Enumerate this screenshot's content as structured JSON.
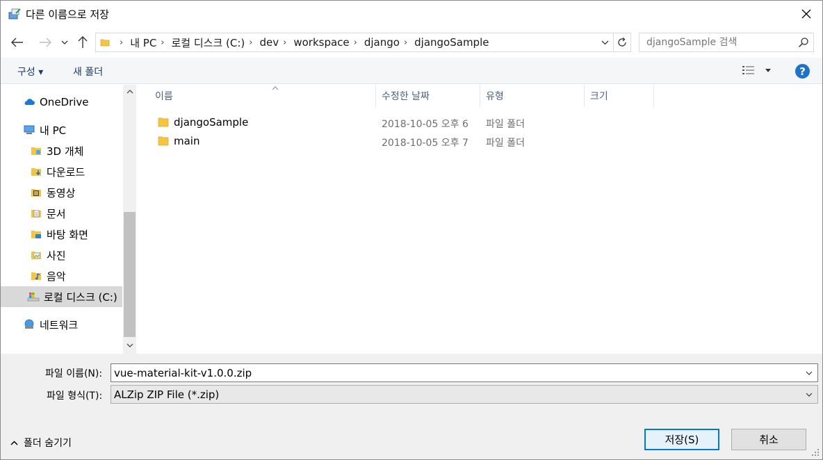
{
  "window": {
    "title": "다른 이름으로 저장"
  },
  "address": {
    "crumbs": [
      "내 PC",
      "로컬 디스크 (C:)",
      "dev",
      "workspace",
      "django",
      "djangoSample"
    ]
  },
  "search": {
    "placeholder": "djangoSample 검색"
  },
  "toolbar": {
    "organize_label": "구성 ▾",
    "new_folder_label": "새 폴더"
  },
  "nav": {
    "items": [
      {
        "label": "OneDrive",
        "icon": "cloud-icon"
      },
      {
        "label": "내 PC",
        "icon": "computer-icon"
      },
      {
        "label": "3D 개체",
        "icon": "3d-objects-icon"
      },
      {
        "label": "다운로드",
        "icon": "download-folder-icon"
      },
      {
        "label": "동영상",
        "icon": "video-folder-icon"
      },
      {
        "label": "문서",
        "icon": "documents-folder-icon"
      },
      {
        "label": "바탕 화면",
        "icon": "desktop-folder-icon"
      },
      {
        "label": "사진",
        "icon": "pictures-folder-icon"
      },
      {
        "label": "음악",
        "icon": "music-folder-icon"
      },
      {
        "label": "로컬 디스크 (C:)",
        "icon": "drive-icon"
      },
      {
        "label": "네트워크",
        "icon": "network-icon"
      }
    ]
  },
  "filelist": {
    "columns": [
      "이름",
      "수정한 날짜",
      "유형",
      "크기"
    ],
    "rows": [
      {
        "name": "djangoSample",
        "date": "2018-10-05 오후 6",
        "type": "파일 폴더"
      },
      {
        "name": "main",
        "date": "2018-10-05 오후 7",
        "type": "파일 폴더"
      }
    ]
  },
  "fields": {
    "filename_label": "파일 이름(N):",
    "filename_value": "vue-material-kit-v1.0.0.zip",
    "filetype_label": "파일 형식(T):",
    "filetype_value": "ALZip ZIP File (*.zip)"
  },
  "footer": {
    "hide_folders_label": "폴더 숨기기",
    "save_label": "저장(S)",
    "cancel_label": "취소"
  },
  "colors": {
    "accent": "#0078d7",
    "folder": "#f4c542",
    "help": "#1e73c8"
  }
}
